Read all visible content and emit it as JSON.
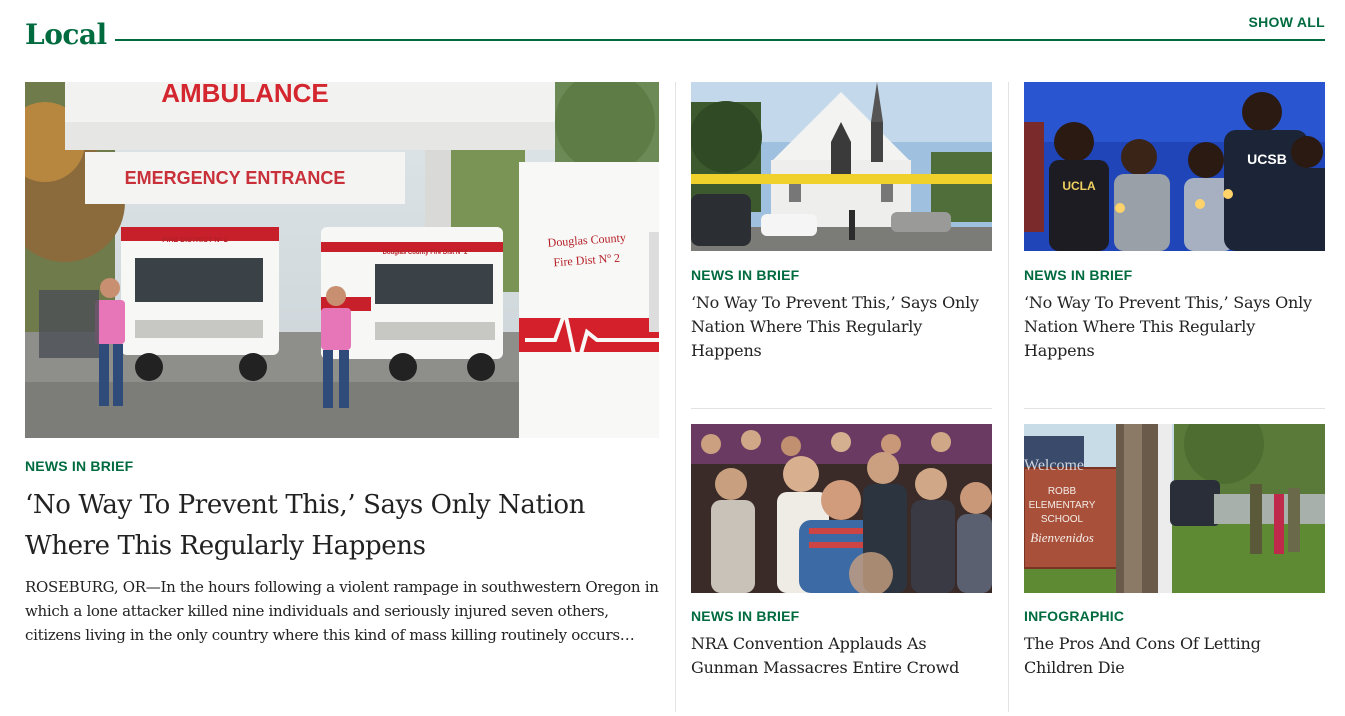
{
  "section": {
    "title": "Local",
    "show_all_label": "SHOW ALL"
  },
  "featured": {
    "image_alt": "Ambulances parked outside a hospital emergency entrance",
    "image_signs": {
      "top": "AMBULANCE",
      "entrance": "EMERGENCY ENTRANCE",
      "truck_door_1": "Douglas County",
      "truck_door_2": "Fire Dist Nº 2",
      "truck_plate_1": "FIRE DISTRICT Nº 2",
      "truck_plate_2": "Douglas County Fire Dist Nº 2"
    },
    "kicker": "NEWS IN BRIEF",
    "headline": "‘No Way To Prevent This,’ Says Only Nation Where This Regularly Happens",
    "excerpt": "ROSEBURG, OR—In the hours following a violent rampage in southwestern Oregon in which a lone attacker killed nine individuals and seriously injured seven others, citizens living in the only country where this kind of mass killing routinely occurs…"
  },
  "cards": [
    {
      "image_alt": "Church behind yellow police tape",
      "kicker": "NEWS IN BRIEF",
      "headline": "‘No Way To Prevent This,’ Says Only Nation Where This Regularly Happens"
    },
    {
      "image_alt": "Students holding candles at a vigil",
      "image_text": {
        "shirt_1": "UCLA",
        "shirt_2": "UCSB"
      },
      "kicker": "NEWS IN BRIEF",
      "headline": "‘No Way To Prevent This,’ Says Only Nation Where This Regularly Happens"
    },
    {
      "image_alt": "Crowd applauding at a convention",
      "kicker": "NEWS IN BRIEF",
      "headline": "NRA Convention Applauds As Gunman Massacres Entire Crowd"
    },
    {
      "image_alt": "Robb Elementary School sign",
      "image_text": {
        "line1": "ROBB",
        "line2": "ELEMENTARY",
        "line3": "SCHOOL",
        "line4": "Bienvenidos",
        "line0": "Welcome"
      },
      "kicker": "INFOGRAPHIC",
      "headline": "The Pros And Cons Of Letting Children Die"
    }
  ],
  "colors": {
    "accent": "#006b3f",
    "text": "#222222",
    "divider": "#e3e3e3"
  }
}
